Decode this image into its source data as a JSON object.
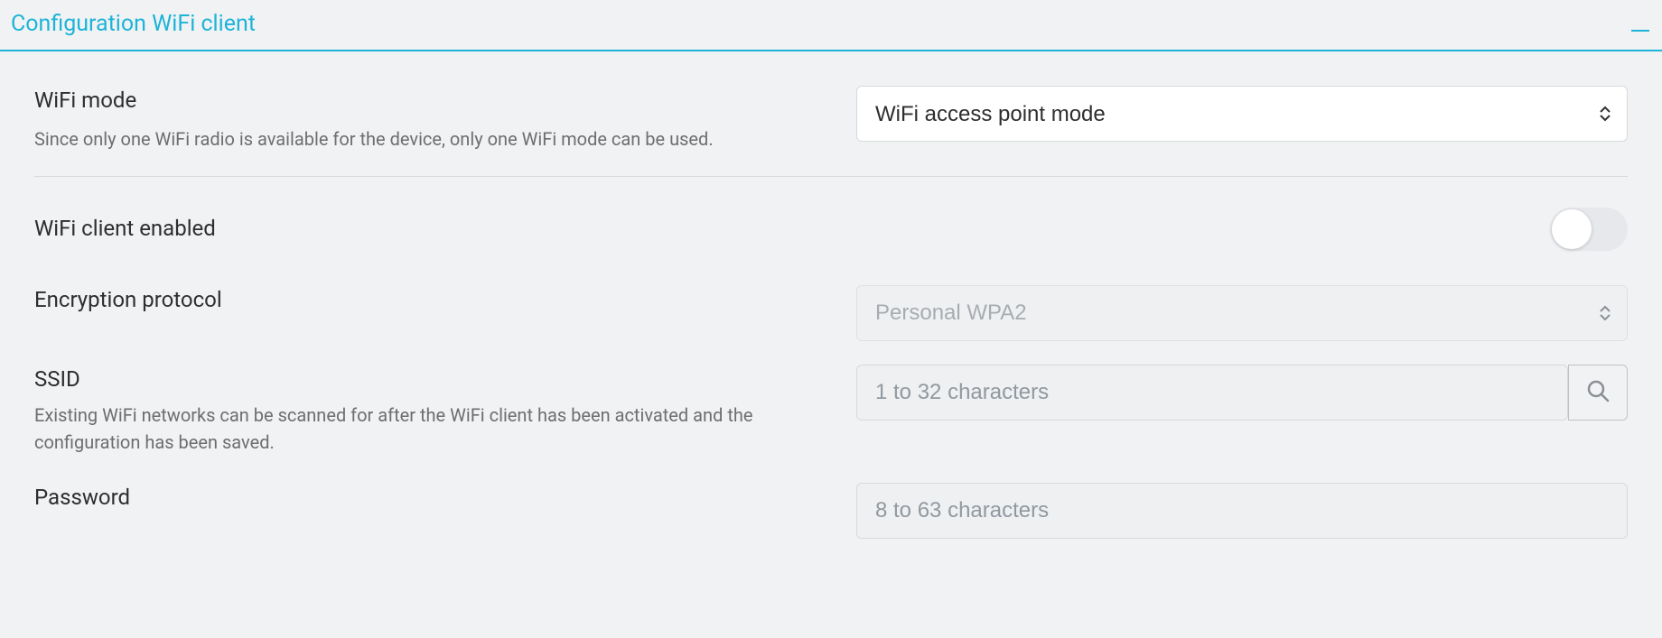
{
  "panel": {
    "title": "Configuration WiFi client"
  },
  "wifi_mode": {
    "label": "WiFi mode",
    "help": "Since only one WiFi radio is available for the device, only one WiFi mode can be used.",
    "selected": "WiFi access point mode"
  },
  "wifi_client_enabled": {
    "label": "WiFi client enabled",
    "value": false
  },
  "encryption": {
    "label": "Encryption protocol",
    "selected": "Personal WPA2"
  },
  "ssid": {
    "label": "SSID",
    "placeholder": "1 to 32 characters",
    "value": "",
    "help": "Existing WiFi networks can be scanned for after the WiFi client has been activated and the configuration has been saved."
  },
  "password": {
    "label": "Password",
    "placeholder": "8 to 63 characters",
    "value": ""
  }
}
